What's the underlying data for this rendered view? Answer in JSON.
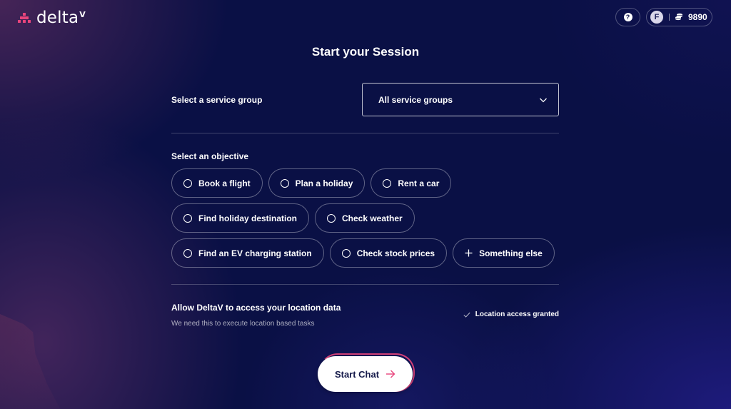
{
  "header": {
    "logo_text": "delta",
    "logo_superscript": "V",
    "help_icon": "question-circle-icon",
    "help_glyph": "?",
    "avatar_initial": "F",
    "credits_icon": "coins-icon",
    "credits": "9890"
  },
  "main": {
    "title": "Start your Session",
    "service_group": {
      "label": "Select a service group",
      "selected": "All service groups"
    },
    "objective": {
      "label": "Select an objective",
      "rows": [
        [
          {
            "label": "Book a flight",
            "icon": "radio"
          },
          {
            "label": "Plan a holiday",
            "icon": "radio"
          },
          {
            "label": "Rent a car",
            "icon": "radio"
          }
        ],
        [
          {
            "label": "Find holiday destination",
            "icon": "radio"
          },
          {
            "label": "Check weather",
            "icon": "radio"
          }
        ],
        [
          {
            "label": "Find an EV charging station",
            "icon": "radio"
          },
          {
            "label": "Check stock prices",
            "icon": "radio"
          },
          {
            "label": "Something else",
            "icon": "plus"
          }
        ]
      ]
    },
    "location": {
      "title": "Allow DeltaV to access your location data",
      "subtitle": "We need this to execute location based tasks",
      "status": "Location access granted"
    },
    "start_button": "Start Chat"
  },
  "colors": {
    "background": "#0a1045",
    "accent": "#e8457c",
    "button_text": "#151a4a"
  }
}
